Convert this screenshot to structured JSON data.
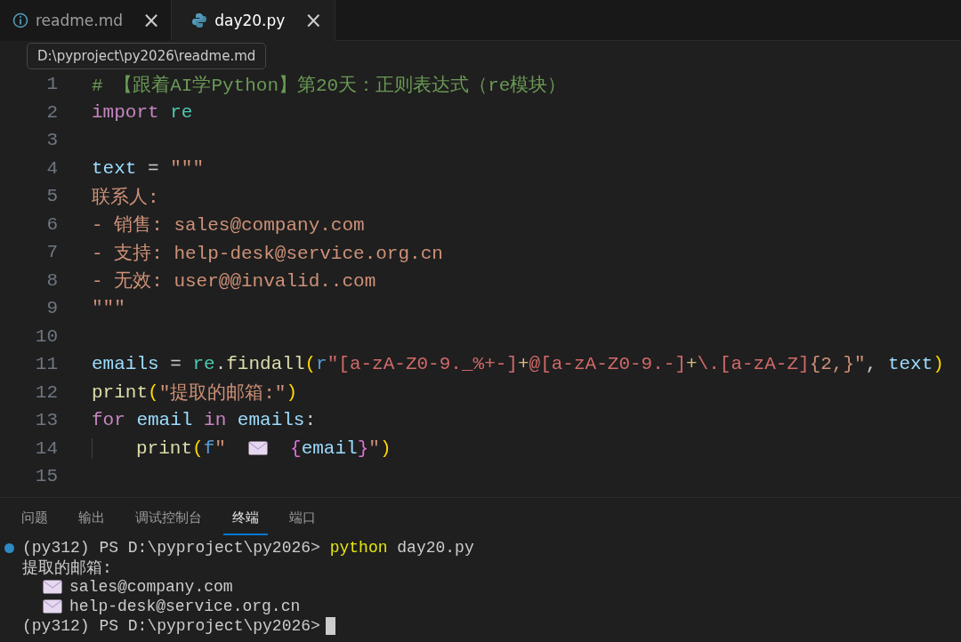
{
  "tabs": [
    {
      "label": "readme.md",
      "kind": "info",
      "selected": false,
      "close": "×"
    },
    {
      "label": "day20.py",
      "kind": "python",
      "selected": true,
      "close": "×"
    }
  ],
  "tooltip": "D:\\pyproject\\py2026\\readme.md",
  "editor": {
    "lines": [
      {
        "number": "1",
        "tokens": [
          {
            "kind": "comment",
            "text": "# 【跟着AI学Python】第20天：正则表达式（re模块）"
          }
        ]
      },
      {
        "number": "2",
        "tokens": [
          {
            "kind": "keyword",
            "text": "import"
          },
          {
            "kind": "module",
            "text": " re"
          }
        ]
      },
      {
        "number": "3"
      },
      {
        "number": "4",
        "tokens": [
          {
            "kind": "variable",
            "text": "text"
          },
          {
            "kind": "plain",
            "text": " = "
          },
          {
            "kind": "string",
            "text": "\"\"\""
          }
        ]
      },
      {
        "number": "5",
        "tokens": [
          {
            "kind": "string",
            "text": "联系人:"
          }
        ]
      },
      {
        "number": "6",
        "tokens": [
          {
            "kind": "string",
            "text": "- 销售: sales@company.com"
          }
        ]
      },
      {
        "number": "7",
        "tokens": [
          {
            "kind": "string",
            "text": "- 支持: help-desk@service.org.cn"
          }
        ]
      },
      {
        "number": "8",
        "tokens": [
          {
            "kind": "string",
            "text": "- 无效: user@@invalid..com"
          }
        ]
      },
      {
        "number": "9",
        "tokens": [
          {
            "kind": "string",
            "text": "\"\"\""
          }
        ]
      },
      {
        "number": "10"
      },
      {
        "number": "11",
        "tokens": [
          {
            "kind": "variable",
            "text": "emails"
          },
          {
            "kind": "plain",
            "text": " = "
          },
          {
            "kind": "module",
            "text": "re"
          },
          {
            "kind": "plain",
            "text": "."
          },
          {
            "kind": "function",
            "text": "findall"
          },
          {
            "kind": "bracket",
            "text": "("
          },
          {
            "kind": "storage",
            "text": "r"
          },
          {
            "kind": "regex",
            "text": "\"[a-zA-Z0-9._%+-]"
          },
          {
            "kind": "regexop",
            "text": "+"
          },
          {
            "kind": "regex",
            "text": "@[a-zA-Z0-9.-]"
          },
          {
            "kind": "regexop",
            "text": "+"
          },
          {
            "kind": "regex",
            "text": "\\.[a-zA-Z]"
          },
          {
            "kind": "string",
            "text": "{2,}\""
          },
          {
            "kind": "plain",
            "text": ", "
          },
          {
            "kind": "variable",
            "text": "text"
          },
          {
            "kind": "bracket",
            "text": ")"
          }
        ]
      },
      {
        "number": "12",
        "tokens": [
          {
            "kind": "function",
            "text": "print"
          },
          {
            "kind": "bracket",
            "text": "("
          },
          {
            "kind": "string",
            "text": "\"提取的邮箱:\""
          },
          {
            "kind": "bracket",
            "text": ")"
          }
        ]
      },
      {
        "number": "13",
        "tokens": [
          {
            "kind": "keyword",
            "text": "for"
          },
          {
            "kind": "variable",
            "text": " email"
          },
          {
            "kind": "keyword",
            "text": " in"
          },
          {
            "kind": "variable",
            "text": " emails"
          },
          {
            "kind": "plain",
            "text": ":"
          }
        ]
      },
      {
        "number": "14",
        "indent": true,
        "tokens": [
          {
            "kind": "function",
            "text": "print"
          },
          {
            "kind": "bracket",
            "text": "("
          },
          {
            "kind": "storage",
            "text": "f"
          },
          {
            "kind": "string",
            "text": "\"  "
          },
          {
            "kind": "envelope"
          },
          {
            "kind": "bracket2",
            "text": "{"
          },
          {
            "kind": "variable",
            "text": "email"
          },
          {
            "kind": "bracket2",
            "text": "}"
          },
          {
            "kind": "string",
            "text": "\""
          },
          {
            "kind": "bracket",
            "text": ")"
          }
        ]
      },
      {
        "number": "15"
      }
    ]
  },
  "panel": {
    "tabs": [
      {
        "label": "问题",
        "selected": false
      },
      {
        "label": "输出",
        "selected": false
      },
      {
        "label": "调试控制台",
        "selected": false
      },
      {
        "label": "终端",
        "selected": true
      },
      {
        "label": "端口",
        "selected": false
      }
    ],
    "terminal": [
      {
        "kind": "prompt",
        "prompt": "(py312) PS D:\\pyproject\\py2026>",
        "command": "python",
        "args": "day20.py"
      },
      {
        "kind": "output",
        "text": "提取的邮箱:"
      },
      {
        "kind": "mail",
        "text": "sales@company.com"
      },
      {
        "kind": "mail",
        "text": "help-desk@service.org.cn"
      },
      {
        "kind": "prompt-cursor",
        "prompt": "(py312) PS D:\\pyproject\\py2026>"
      }
    ]
  }
}
